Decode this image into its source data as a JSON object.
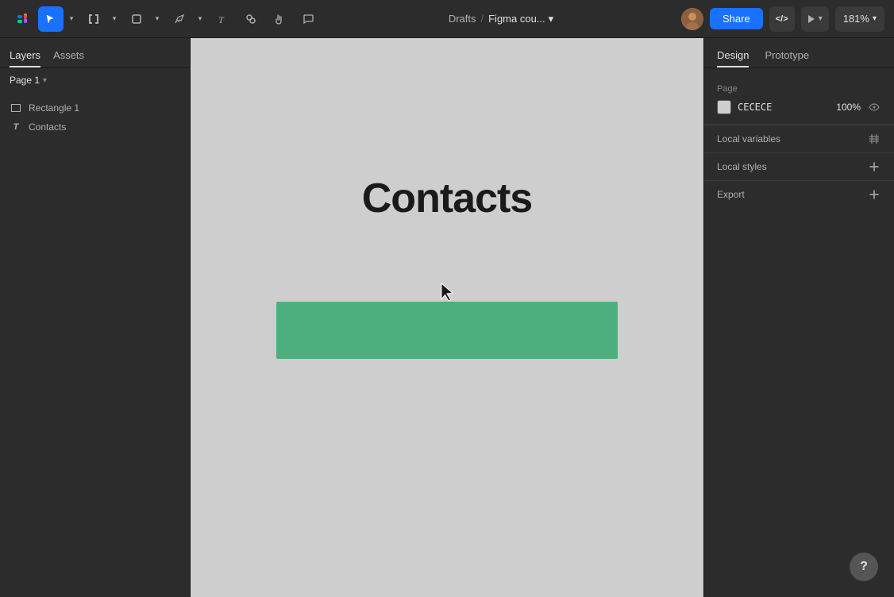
{
  "toolbar": {
    "breadcrumb_drafts": "Drafts",
    "breadcrumb_sep": "/",
    "file_name": "Figma cou...",
    "share_label": "Share",
    "code_label": "</>",
    "zoom_level": "181%"
  },
  "left_sidebar": {
    "tabs": [
      {
        "id": "layers",
        "label": "Layers",
        "active": true
      },
      {
        "id": "assets",
        "label": "Assets",
        "active": false
      }
    ],
    "page": "Page 1",
    "layers": [
      {
        "type": "rect",
        "name": "Rectangle 1"
      },
      {
        "type": "text",
        "name": "Contacts"
      }
    ]
  },
  "canvas": {
    "title": "Contacts",
    "bg_color": "#cecece"
  },
  "right_sidebar": {
    "tabs": [
      {
        "id": "design",
        "label": "Design",
        "active": true
      },
      {
        "id": "prototype",
        "label": "Prototype",
        "active": false
      }
    ],
    "page_section": {
      "label": "Page",
      "color_value": "CECECE",
      "opacity_value": "100%"
    },
    "local_variables_label": "Local variables",
    "local_styles_label": "Local styles",
    "export_label": "Export"
  },
  "help": {
    "label": "?"
  }
}
